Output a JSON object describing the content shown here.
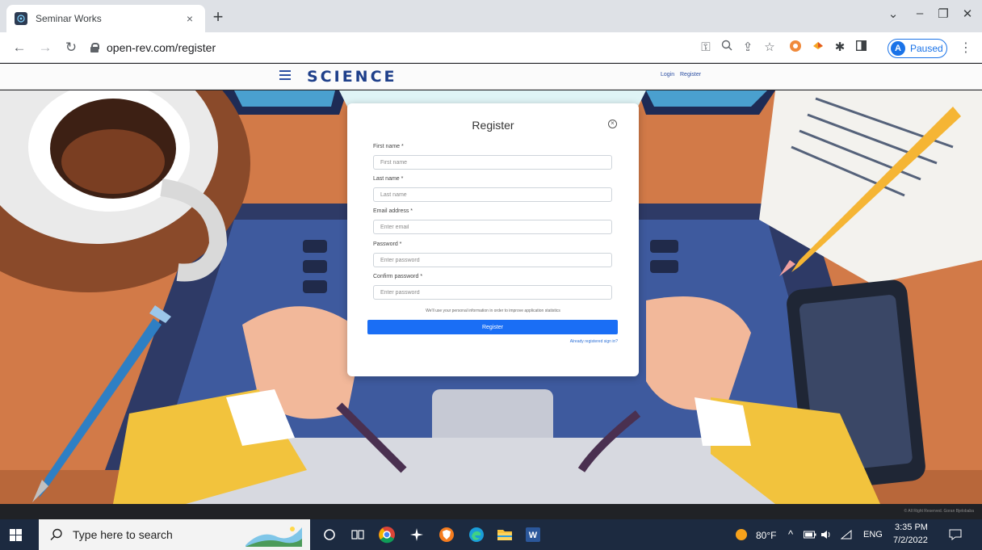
{
  "browser": {
    "tab_title": "Seminar Works",
    "tab_close": "×",
    "new_tab": "+",
    "url": "open-rev.com/register",
    "profile_initial": "A",
    "profile_status": "Paused"
  },
  "site": {
    "logo_text": "SCIENCE",
    "login": "Login",
    "register": "Register",
    "footer": "© All Right Reserved. Goran Bjelobaba"
  },
  "modal": {
    "title": "Register",
    "fields": [
      {
        "label": "First name *",
        "placeholder": "First name"
      },
      {
        "label": "Last name *",
        "placeholder": "Last name"
      },
      {
        "label": "Email address *",
        "placeholder": "Enter email"
      },
      {
        "label": "Password *",
        "placeholder": "Enter password"
      },
      {
        "label": "Confirm password *",
        "placeholder": "Enter password"
      }
    ],
    "note": "We'll use your personal information in order to improve application statistics",
    "button": "Register",
    "already": "Already registered sign in?"
  },
  "taskbar": {
    "search_placeholder": "Type here to search",
    "weather": "80°F",
    "language": "ENG",
    "time": "3:35 PM",
    "date": "7/2/2022"
  },
  "colors": {
    "accent": "#1a6ef5",
    "hero_bg": "#d27a48",
    "taskbar": "#1c2a40"
  }
}
